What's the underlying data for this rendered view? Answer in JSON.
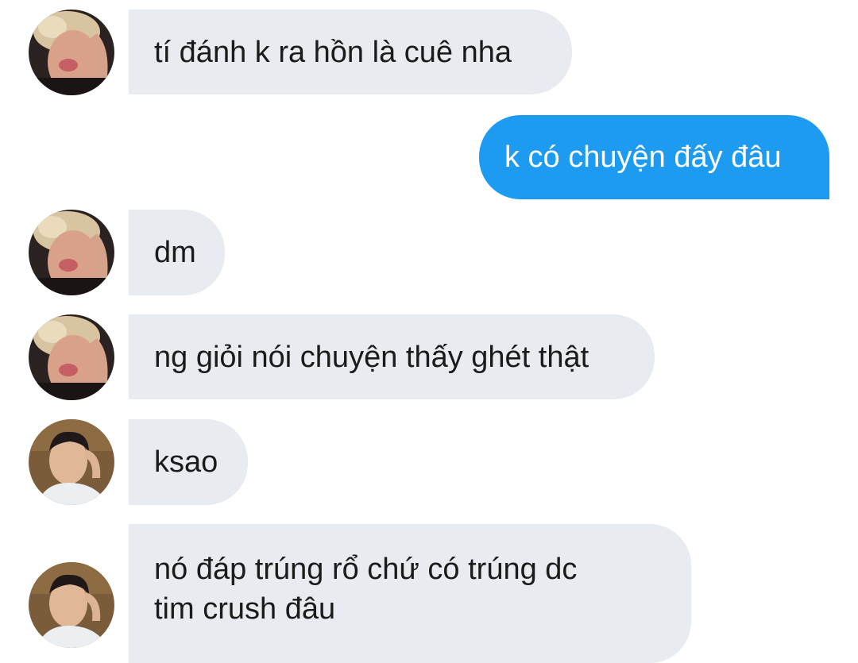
{
  "conversation": {
    "messages": [
      {
        "sender": "other-user-1",
        "direction": "incoming",
        "text": "tí đánh k ra hồn là cuê nha"
      },
      {
        "sender": "me",
        "direction": "outgoing",
        "text": "k có chuyện đấy đâu"
      },
      {
        "sender": "other-user-1",
        "direction": "incoming",
        "text": "dm"
      },
      {
        "sender": "other-user-1",
        "direction": "incoming",
        "text": "ng giỏi nói chuyện thấy ghét thật"
      },
      {
        "sender": "other-user-2",
        "direction": "incoming",
        "text": "ksao"
      },
      {
        "sender": "other-user-2",
        "direction": "incoming",
        "lines": [
          "nó đáp trúng rổ chứ có trúng dc",
          "tim crush đâu"
        ]
      }
    ]
  },
  "colors": {
    "incoming_bubble": "#e8ecf0",
    "outgoing_bubble": "#1d9bf0",
    "incoming_text": "#1b1b1b",
    "outgoing_text": "#ffffff"
  },
  "icons": {
    "avatar_user_1": "blond-hair-avatar",
    "avatar_user_2": "dark-hair-avatar"
  }
}
